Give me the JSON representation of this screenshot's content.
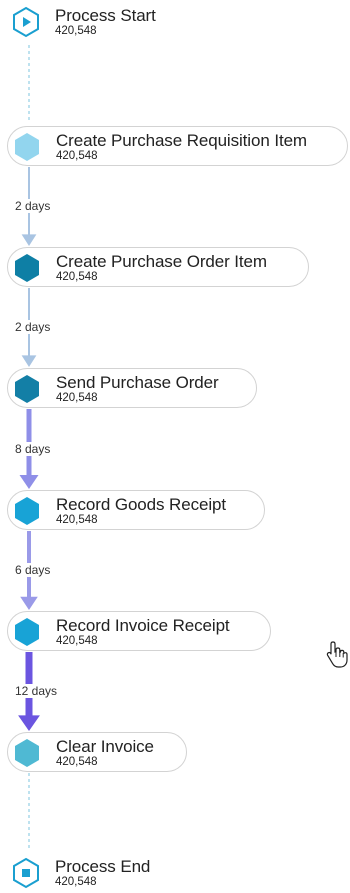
{
  "nodes": [
    {
      "id": "process-start",
      "label": "Process Start",
      "count": "420,548",
      "kind": "start",
      "color": "#1a9fd0"
    },
    {
      "id": "create-purchase-requisition-item",
      "label": "Create Purchase Requisition Item",
      "count": "420,548",
      "kind": "activity",
      "color": "#92d5ee"
    },
    {
      "id": "create-purchase-order-item",
      "label": "Create Purchase Order Item",
      "count": "420,548",
      "kind": "activity",
      "color": "#0e7fa5"
    },
    {
      "id": "send-purchase-order",
      "label": "Send Purchase Order",
      "count": "420,548",
      "kind": "activity",
      "color": "#137fa6"
    },
    {
      "id": "record-goods-receipt",
      "label": "Record Goods Receipt",
      "count": "420,548",
      "kind": "activity",
      "color": "#18a3d6"
    },
    {
      "id": "record-invoice-receipt",
      "label": "Record Invoice Receipt",
      "count": "420,548",
      "kind": "activity",
      "color": "#18a3d6"
    },
    {
      "id": "clear-invoice",
      "label": "Clear Invoice",
      "count": "420,548",
      "kind": "activity",
      "color": "#4fb9d3"
    },
    {
      "id": "process-end",
      "label": "Process End",
      "count": "420,548",
      "kind": "end",
      "color": "#1a9fd0"
    }
  ],
  "edges": [
    {
      "from": "process-start",
      "to": "create-purchase-requisition-item",
      "label": "",
      "style": "dashed",
      "color": "#a8d8ea"
    },
    {
      "from": "create-purchase-requisition-item",
      "to": "create-purchase-order-item",
      "label": "2 days",
      "style": "solid",
      "color": "#a9c4e2"
    },
    {
      "from": "create-purchase-order-item",
      "to": "send-purchase-order",
      "label": "2 days",
      "style": "solid",
      "color": "#a9c4e2"
    },
    {
      "from": "send-purchase-order",
      "to": "record-goods-receipt",
      "label": "8 days",
      "style": "solid",
      "color": "#8f8fe8"
    },
    {
      "from": "record-goods-receipt",
      "to": "record-invoice-receipt",
      "label": "6 days",
      "style": "solid",
      "color": "#9a9ae8"
    },
    {
      "from": "record-invoice-receipt",
      "to": "clear-invoice",
      "label": "12 days",
      "style": "solid",
      "color": "#6b55e0"
    },
    {
      "from": "clear-invoice",
      "to": "process-end",
      "label": "",
      "style": "dashed",
      "color": "#a8d8ea"
    }
  ]
}
